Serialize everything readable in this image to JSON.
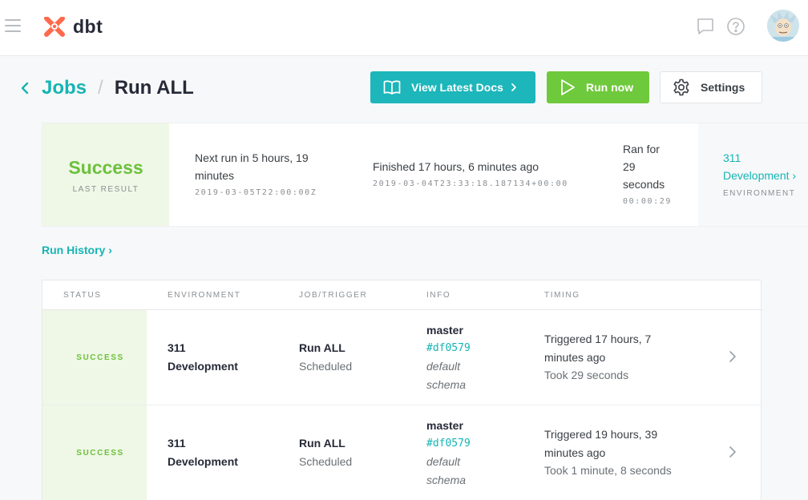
{
  "app": {
    "name": "dbt"
  },
  "breadcrumb": {
    "parent": "Jobs",
    "separator": "/",
    "current": "Run ALL"
  },
  "actions": {
    "docs_label": "View Latest Docs",
    "run_label": "Run now",
    "settings_label": "Settings"
  },
  "summary": {
    "status": "Success",
    "status_caption": "LAST RESULT",
    "next_run_line1": "Next run in 5 hours, 19",
    "next_run_line2": "minutes",
    "next_run_ts": "2019-03-05T22:00:00Z",
    "finished": "Finished 17 hours, 6 minutes ago",
    "finished_ts": "2019-03-04T23:33:18.187134+00:00",
    "ran_line1": "Ran for",
    "ran_line2": "29",
    "ran_line3": "seconds",
    "duration": "00:00:29",
    "env_line1": "311",
    "env_line2": "Development ›",
    "env_caption": "ENVIRONMENT"
  },
  "run_history_label": "Run History ›",
  "table": {
    "headers": [
      "STATUS",
      "ENVIRONMENT",
      "JOB/TRIGGER",
      "INFO",
      "TIMING"
    ],
    "rows": [
      {
        "status": "SUCCESS",
        "env_line1": "311",
        "env_line2": "Development",
        "job": "Run ALL",
        "trigger": "Scheduled",
        "branch": "master",
        "sha": "#df0579",
        "schema_line1": "default",
        "schema_line2": "schema",
        "timing_line1": "Triggered 17 hours, 7",
        "timing_line2": "minutes ago",
        "took": "Took 29 seconds"
      },
      {
        "status": "SUCCESS",
        "env_line1": "311",
        "env_line2": "Development",
        "job": "Run ALL",
        "trigger": "Scheduled",
        "branch": "master",
        "sha": "#df0579",
        "schema_line1": "default",
        "schema_line2": "schema",
        "timing_line1": "Triggered 19 hours, 39",
        "timing_line2": "minutes ago",
        "took": "Took 1 minute, 8 seconds"
      }
    ]
  },
  "colors": {
    "accent": "#16b4b4",
    "docs_button": "#1cb6bb",
    "run_button": "#6fc93c",
    "success_text": "#6cc13c",
    "success_bg": "#eff7e6",
    "logo": "#ff694b"
  },
  "icons": {
    "menu": "hamburger-icon",
    "logo": "dbt-logo-icon",
    "chat": "chat-icon",
    "help": "help-icon",
    "back": "chevron-left-icon",
    "docs": "book-icon",
    "run": "play-icon",
    "settings": "gear-icon",
    "row": "chevron-right-icon"
  }
}
